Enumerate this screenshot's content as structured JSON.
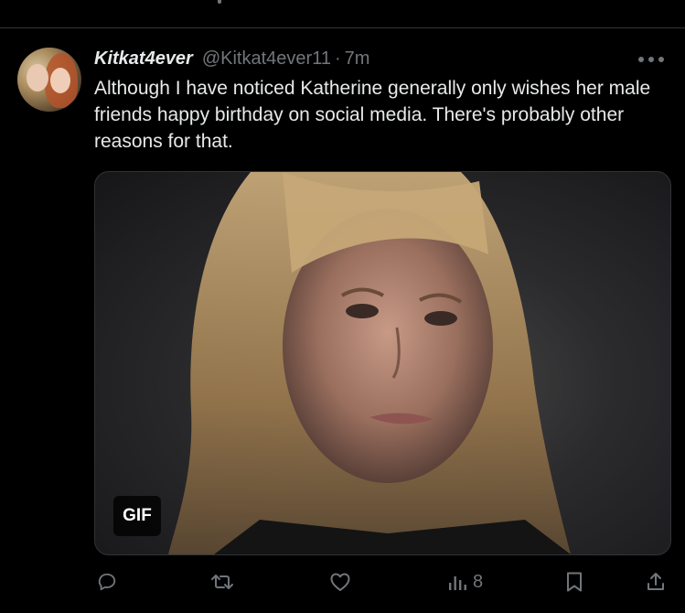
{
  "post": {
    "author": {
      "display_name": "Kitkat4ever",
      "handle": "@Kitkat4ever11",
      "separator": "·",
      "time": "7m"
    },
    "text": "Although I have noticed Katherine generally only wishes her male friends happy birthday on social media. There's probably other reasons for that.",
    "media": {
      "badge": "GIF"
    },
    "actions": {
      "reply_icon": "reply-icon",
      "repost_icon": "repost-icon",
      "like_icon": "like-icon",
      "views_icon": "views-icon",
      "views_count": "8",
      "bookmark_icon": "bookmark-icon",
      "share_icon": "share-icon"
    }
  },
  "colors": {
    "background": "#000000",
    "text_primary": "#e7e9ea",
    "text_secondary": "#71767b",
    "divider": "#2f3336"
  }
}
